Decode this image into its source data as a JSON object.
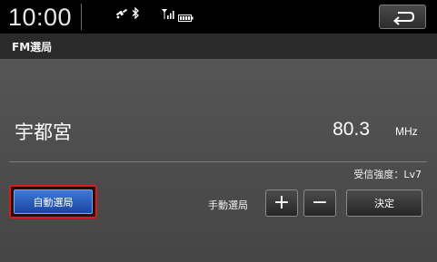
{
  "status_bar": {
    "time": "10:00",
    "icons": [
      "gps-icon",
      "bluetooth-icon",
      "signal-icon",
      "battery-icon"
    ]
  },
  "header": {
    "back_icon": "back-arrow-icon",
    "title": "FM選局"
  },
  "station": {
    "name": "宇都宮",
    "frequency": "80.3",
    "unit": "MHz",
    "signal_strength": "受信強度：Lv7"
  },
  "controls": {
    "auto_tune": "自動選局",
    "manual_tune_label": "手動選局",
    "plus": "+",
    "minus": "−",
    "confirm": "決定"
  },
  "colors": {
    "auto_button": "#2b5fc4",
    "highlight_border": "#e01818",
    "background": "#4b4b4b"
  }
}
